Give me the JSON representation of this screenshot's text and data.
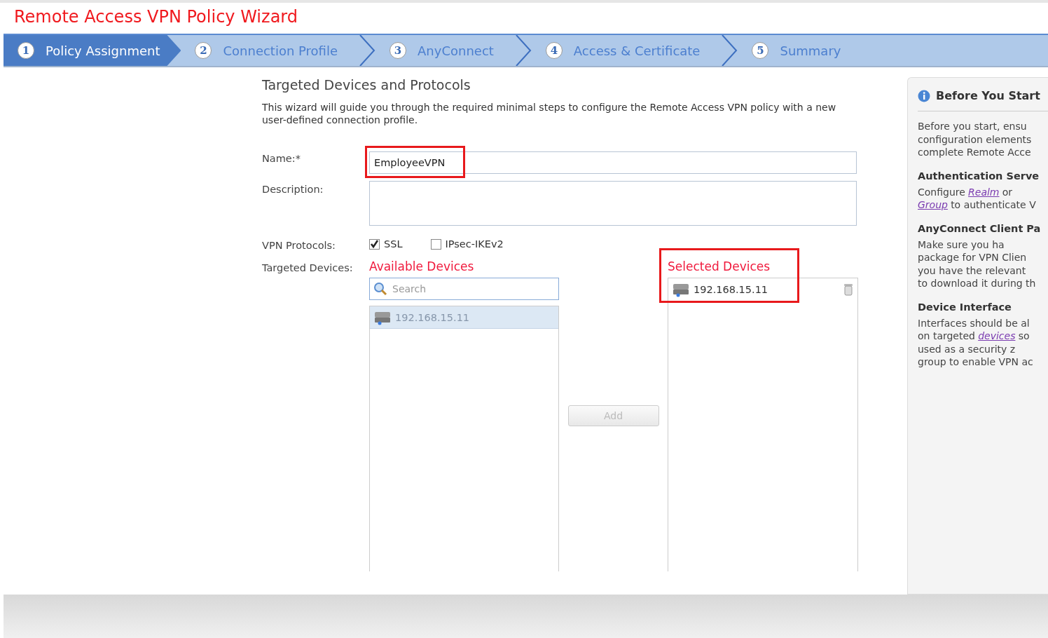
{
  "wizard_title": "Remote Access VPN Policy Wizard",
  "steps": [
    {
      "number": "1",
      "label": "Policy Assignment",
      "selected": true
    },
    {
      "number": "2",
      "label": "Connection Profile",
      "selected": false
    },
    {
      "number": "3",
      "label": "AnyConnect",
      "selected": false
    },
    {
      "number": "4",
      "label": "Access & Certificate",
      "selected": false
    },
    {
      "number": "5",
      "label": "Summary",
      "selected": false
    }
  ],
  "section": {
    "heading": "Targeted Devices and Protocols",
    "intro": "This wizard will guide you through the required minimal steps to configure the Remote Access VPN policy with a new user-defined connection profile."
  },
  "name_field": {
    "label": "Name:*",
    "value": "EmployeeVPN",
    "highlighted": true
  },
  "description_field": {
    "label": "Description:"
  },
  "protocols": {
    "label": "VPN Protocols:",
    "options": [
      {
        "label": "SSL",
        "checked": true
      },
      {
        "label": "IPsec-IKEv2",
        "checked": false
      }
    ]
  },
  "targeted_devices": {
    "label": "Targeted Devices:",
    "available": {
      "title": "Available Devices",
      "search_placeholder": "Search",
      "items": [
        {
          "label": "192.168.15.11",
          "disabled": true
        }
      ]
    },
    "add_button": {
      "label": "Add",
      "disabled": true
    },
    "selected": {
      "title": "Selected Devices",
      "highlighted": true,
      "items": [
        {
          "label": "192.168.15.11",
          "disabled": false
        }
      ]
    }
  },
  "info_panel": {
    "title": "Before You Start",
    "sections": [
      {
        "lines": [
          [
            {
              "text": "Before you start, ensu",
              "kind": "text"
            }
          ],
          [
            {
              "text": "configuration elements",
              "kind": "text"
            }
          ],
          [
            {
              "text": "complete Remote Acce",
              "kind": "text"
            }
          ]
        ]
      },
      {
        "heading": "Authentication Serve",
        "lines": [
          [
            {
              "text": "Configure",
              "kind": "text"
            },
            {
              "text": "Realm",
              "kind": "link"
            },
            {
              "text": "or",
              "kind": "text"
            }
          ],
          [
            {
              "text": "Group",
              "kind": "link"
            },
            {
              "text": "to authenticate V",
              "kind": "text"
            }
          ]
        ]
      },
      {
        "heading": "AnyConnect Client Pa",
        "lines": [
          [
            {
              "text": "Make sure you ha",
              "kind": "text"
            }
          ],
          [
            {
              "text": "package for VPN Clien",
              "kind": "text"
            }
          ],
          [
            {
              "text": "you have the relevant",
              "kind": "text"
            }
          ],
          [
            {
              "text": "to download it during th",
              "kind": "text"
            }
          ]
        ]
      },
      {
        "heading": "Device Interface",
        "lines": [
          [
            {
              "text": "Interfaces should be al",
              "kind": "text"
            }
          ],
          [
            {
              "text": "on targeted",
              "kind": "text"
            },
            {
              "text": "devices",
              "kind": "link"
            },
            {
              "text": "so",
              "kind": "text"
            }
          ],
          [
            {
              "text": "used as a security z",
              "kind": "text"
            }
          ],
          [
            {
              "text": "group to enable VPN ac",
              "kind": "text"
            }
          ]
        ]
      }
    ]
  }
}
